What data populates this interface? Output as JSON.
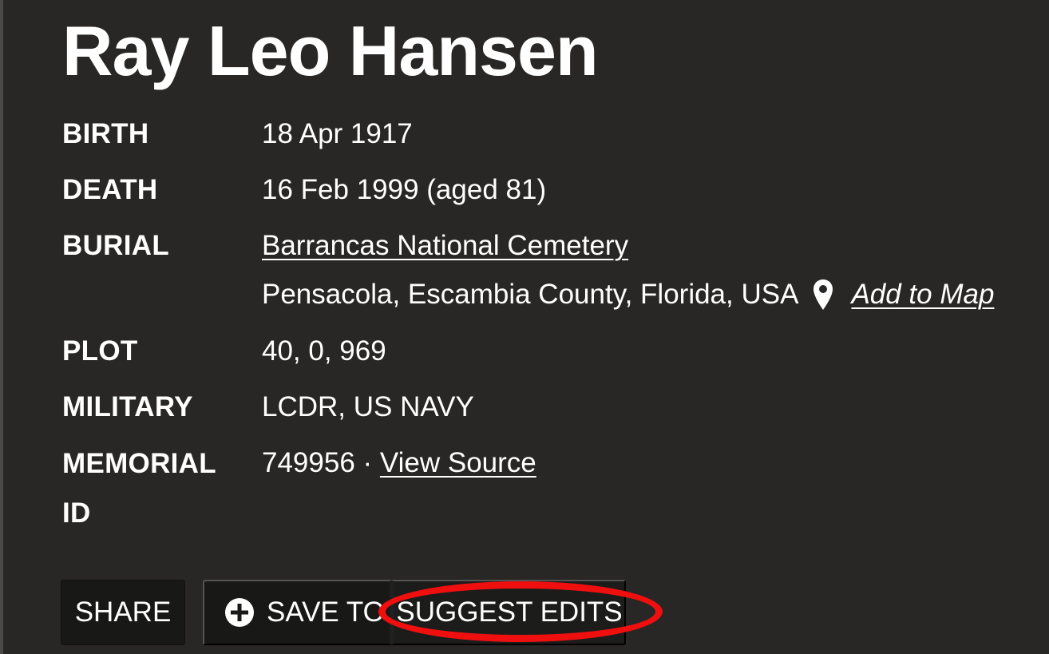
{
  "memorial": {
    "name": "Ray Leo Hansen"
  },
  "facts": {
    "birth": {
      "label": "BIRTH",
      "value": "18 Apr 1917"
    },
    "death": {
      "label": "DEATH",
      "value": "16 Feb 1999 (aged 81)"
    },
    "burial": {
      "label": "BURIAL",
      "cemetery": "Barrancas National Cemetery",
      "location": "Pensacola, Escambia County, Florida, USA",
      "add_to_map": "Add to Map",
      "icon": "map-pin-icon"
    },
    "plot": {
      "label": "PLOT",
      "value": "40, 0, 969"
    },
    "military": {
      "label": "MILITARY",
      "value": "LCDR, US NAVY"
    },
    "memorial_id": {
      "label": "MEMORIAL ID",
      "value": "749956",
      "separator": "·",
      "view_source": "View Source"
    }
  },
  "actions": {
    "share": "SHARE",
    "save_to": "SAVE TO",
    "save_icon": "plus-circle-icon",
    "suggest_edits": "SUGGEST EDITS"
  },
  "colors": {
    "background": "#282725",
    "button_background": "#181817",
    "text": "#ffffff",
    "highlight": "#ef0f0f"
  }
}
